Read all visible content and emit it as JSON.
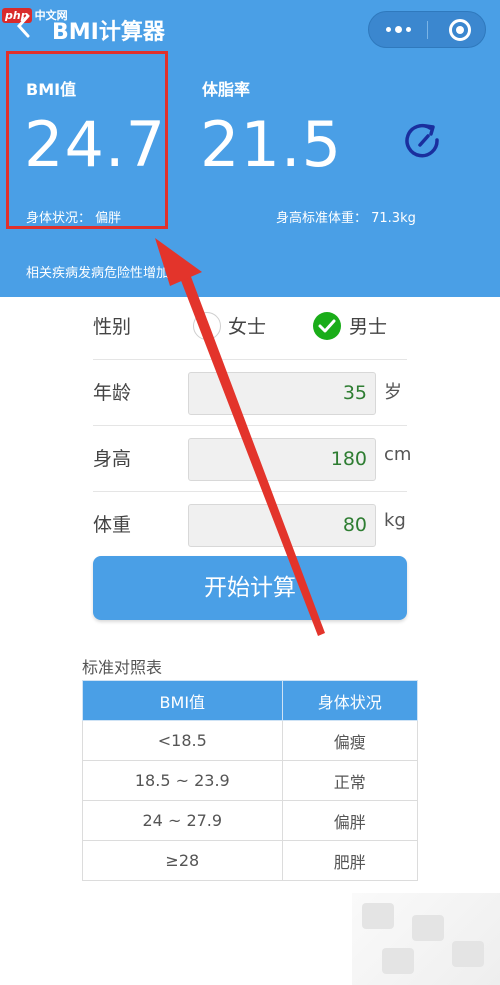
{
  "watermark": {
    "logo": "php",
    "text": "中文网"
  },
  "header": {
    "back_icon": "chevron-left-icon",
    "title": "BMI计算器",
    "capsule": {
      "more_icon": "more-dots-icon",
      "close_icon": "target-close-icon"
    }
  },
  "result": {
    "bmi_label": "BMI值",
    "bmi_value": "24.7",
    "body_status": "身体状况：  偏胖",
    "fat_label": "体脂率",
    "fat_value": "21.5",
    "standard_weight": "身高标准体重：  71.3kg",
    "refresh_icon": "refresh-icon",
    "risk_note": "相关疾病发病危险性增加"
  },
  "form": {
    "gender_label": "性别",
    "female_label": "女士",
    "male_label": "男士",
    "selected_gender": "male",
    "age_label": "年龄",
    "age_value": "35",
    "age_unit": "岁",
    "height_label": "身高",
    "height_value": "180",
    "height_unit": "cm",
    "weight_label": "体重",
    "weight_value": "80",
    "weight_unit": "kg",
    "submit_label": "开始计算"
  },
  "reference_table": {
    "title": "标准对照表",
    "headers": [
      "BMI值",
      "身体状况"
    ],
    "rows": [
      [
        "<18.5",
        "偏瘦"
      ],
      [
        "18.5 ~ 23.9",
        "正常"
      ],
      [
        "24 ~ 27.9",
        "偏胖"
      ],
      [
        "≥28",
        "肥胖"
      ]
    ]
  },
  "colors": {
    "primary": "#4a9fe6",
    "highlight": "#e0302b",
    "check": "#1aad19",
    "input_text": "#2e7d32"
  }
}
